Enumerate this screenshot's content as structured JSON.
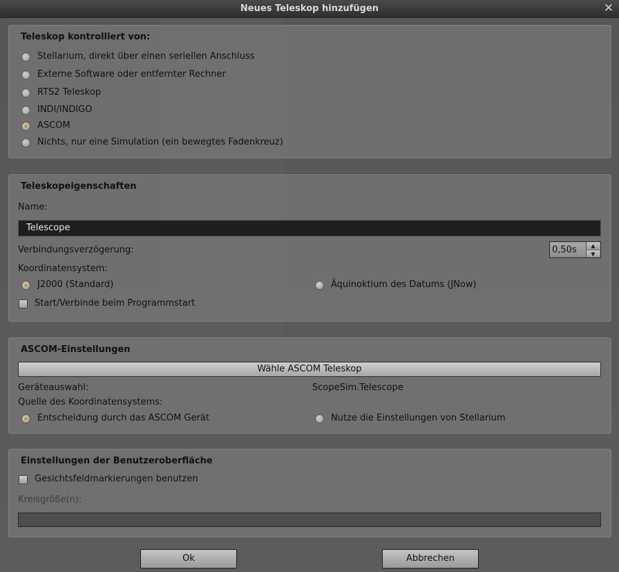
{
  "window": {
    "title": "Neues Teleskop hinzufügen"
  },
  "control_group": {
    "title": "Teleskop kontrolliert von:",
    "options": [
      {
        "label": "Stellarium, direkt über einen seriellen Anschluss",
        "checked": false
      },
      {
        "label": "Externe Software oder entfernter Rechner",
        "checked": false
      },
      {
        "label": "RTS2 Teleskop",
        "checked": false
      },
      {
        "label": "INDI/INDIGO",
        "checked": false
      },
      {
        "label": "ASCOM",
        "checked": true
      },
      {
        "label": "Nichts, nur eine Simulation (ein bewegtes Fadenkreuz)",
        "checked": false
      }
    ]
  },
  "properties": {
    "title": "Teleskopeigenschaften",
    "name_label": "Name:",
    "name_value": "Telescope",
    "delay_label": "Verbindungsverzögerung:",
    "delay_value": "0,50s",
    "coord_label": "Koordinatensystem:",
    "coord_j2000": "J2000 (Standard)",
    "coord_jnow": "Äquinoktium des Datums (JNow)",
    "coord_selected": "J2000",
    "autostart_label": "Start/Verbinde beim Programmstart",
    "autostart_checked": false
  },
  "ascom": {
    "title": "ASCOM-Einstellungen",
    "choose_button": "Wähle ASCOM Teleskop",
    "device_label": "Geräteauswahl:",
    "device_value": "ScopeSim.Telescope",
    "source_label": "Quelle des Koordinatensystems:",
    "source_device": "Entscheidung durch das ASCOM Gerät",
    "source_stellarium": "Nutze die Einstellungen von Stellarium",
    "source_selected": "device"
  },
  "ui_settings": {
    "title": "Einstellungen der Benutzeroberfläche",
    "fov_label": "Gesichtsfeldmarkierungen benutzen",
    "fov_checked": false,
    "circle_label": "Kreisgröße(n):",
    "circle_value": ""
  },
  "buttons": {
    "ok": "Ok",
    "cancel": "Abbrechen"
  },
  "colors": {
    "radio_accent": "#c69a1a",
    "dialog_bg": "#606060",
    "input_bg": "#1e1e1e"
  }
}
